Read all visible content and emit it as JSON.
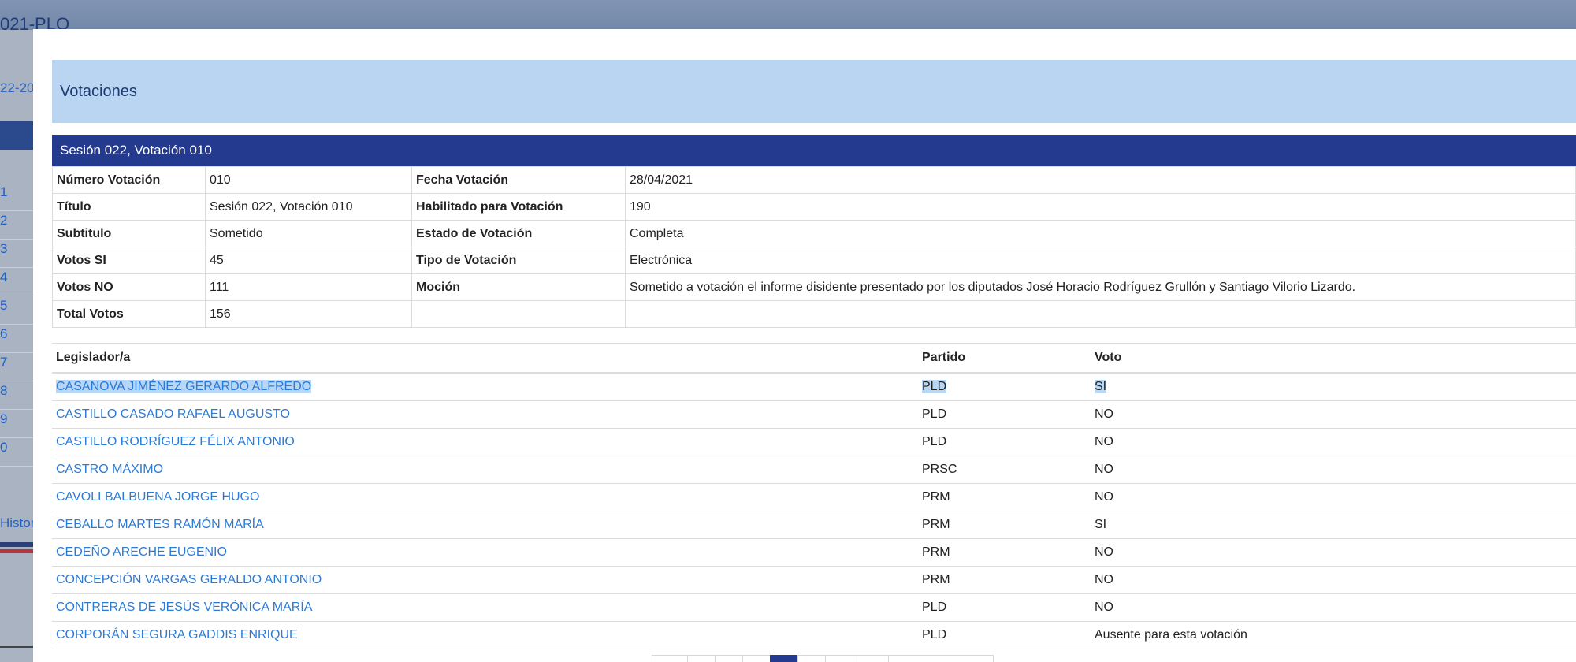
{
  "background": {
    "title_fragment": "021-PLO",
    "year_fragment": "22-20",
    "list_numbers": [
      "1",
      "2",
      "3",
      "4",
      "5",
      "6",
      "7",
      "8",
      "9",
      "0"
    ],
    "history_fragment": "Histori"
  },
  "modal": {
    "title": "Votaciones",
    "panel_title": "Sesión 022, Votación 010",
    "info": {
      "numero_label": "Número Votación",
      "numero_value": "010",
      "fecha_label": "Fecha Votación",
      "fecha_value": "28/04/2021",
      "titulo_label": "Título",
      "titulo_value": "Sesión 022, Votación 010",
      "habilitado_label": "Habilitado para Votación",
      "habilitado_value": "190",
      "subtitulo_label": "Subtitulo",
      "subtitulo_value": "Sometido",
      "estado_label": "Estado de Votación",
      "estado_value": "Completa",
      "votos_si_label": "Votos SI",
      "votos_si_value": "45",
      "tipo_label": "Tipo de Votación",
      "tipo_value": "Electrónica",
      "votos_no_label": "Votos NO",
      "votos_no_value": "111",
      "mocion_label": "Moción",
      "mocion_value": "Sometido a votación el informe disidente presentado por los diputados José Horacio Rodríguez Grullón y Santiago Vilorio Lizardo.",
      "total_label": "Total Votos",
      "total_value": "156"
    },
    "votes_table": {
      "headers": [
        "Legislador/a",
        "Partido",
        "Voto"
      ],
      "rows": [
        {
          "name": "CASANOVA JIMÉNEZ GERARDO ALFREDO",
          "party": "PLD",
          "vote": "SI"
        },
        {
          "name": "CASTILLO CASADO RAFAEL AUGUSTO",
          "party": "PLD",
          "vote": "NO"
        },
        {
          "name": "CASTILLO RODRÍGUEZ FÉLIX ANTONIO",
          "party": "PLD",
          "vote": "NO"
        },
        {
          "name": "CASTRO MÁXIMO",
          "party": "PRSC",
          "vote": "NO"
        },
        {
          "name": "CAVOLI BALBUENA JORGE HUGO",
          "party": "PRM",
          "vote": "NO"
        },
        {
          "name": "CEBALLO MARTES RAMÓN MARÍA",
          "party": "PRM",
          "vote": "SI"
        },
        {
          "name": "CEDEÑO ARECHE EUGENIO",
          "party": "PRM",
          "vote": "NO"
        },
        {
          "name": "CONCEPCIÓN VARGAS GERALDO ANTONIO",
          "party": "PRM",
          "vote": "NO"
        },
        {
          "name": "CONTRERAS DE JESÚS VERÓNICA MARÍA",
          "party": "PLD",
          "vote": "NO"
        },
        {
          "name": "CORPORÁN SEGURA GADDIS ENRIQUE",
          "party": "PLD",
          "vote": "Ausente para esta votación"
        }
      ]
    }
  },
  "colors": {
    "panel_header": "#243a8f",
    "modal_header": "#bad5f2",
    "link": "#2b7bd6",
    "selection": "#b8d6f6"
  }
}
